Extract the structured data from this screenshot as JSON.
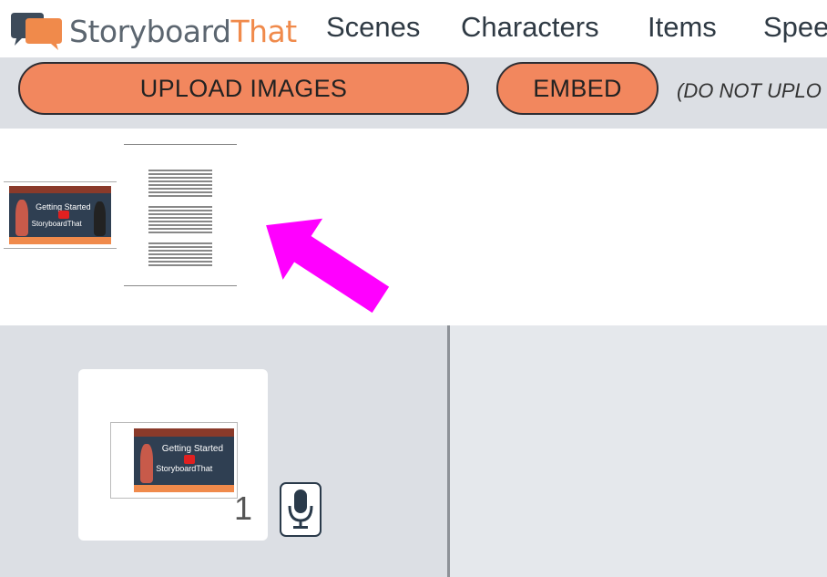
{
  "brand": {
    "story": "Storyboard",
    "that": "That"
  },
  "nav": [
    "Scenes",
    "Characters",
    "Items",
    "Speech"
  ],
  "toolbar": {
    "upload_label": "UPLOAD IMAGES",
    "embed_label": "EMBED",
    "note": "(DO NOT UPLO"
  },
  "thumbnail": {
    "title": "Getting Started",
    "brand": "StoryboardThat"
  },
  "cell": {
    "number": "1"
  },
  "colors": {
    "accent": "#f2875e",
    "arrow": "#ff00ff",
    "toolbar_bg": "#dcdfe4"
  }
}
